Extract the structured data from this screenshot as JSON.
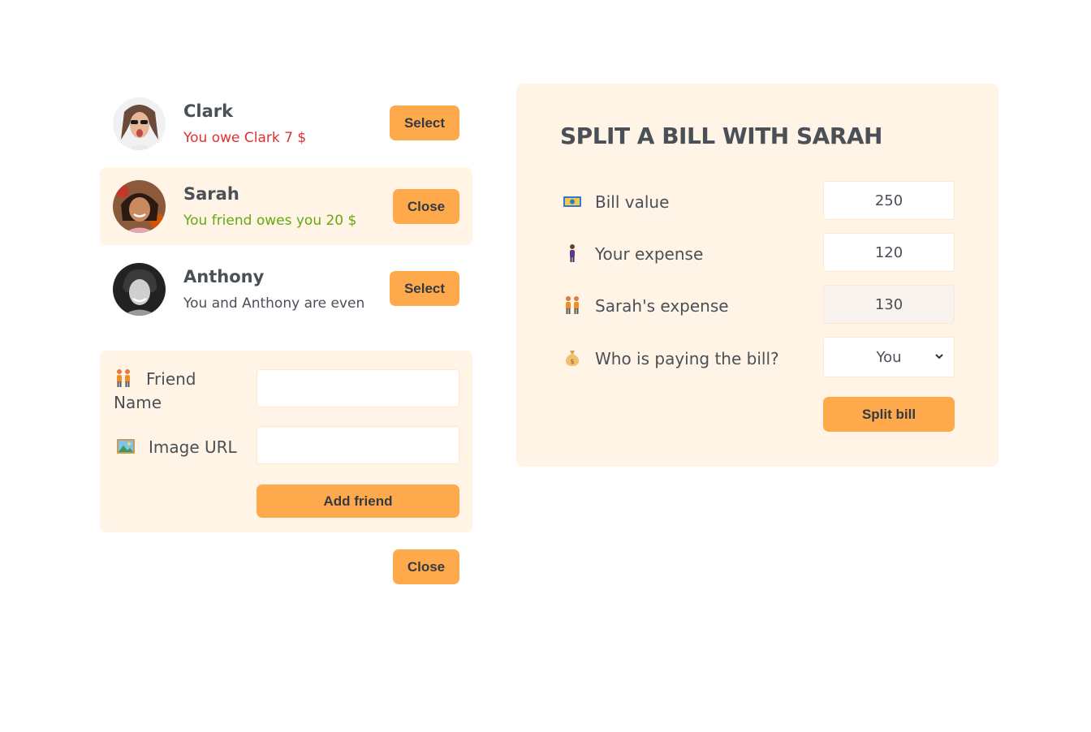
{
  "friends": [
    {
      "name": "Clark",
      "status": "You owe Clark 7 $",
      "button": "Select",
      "selected": false
    },
    {
      "name": "Sarah",
      "status": "You friend owes you 20 $",
      "button": "Close",
      "selected": true
    },
    {
      "name": "Anthony",
      "status": "You and Anthony are even",
      "button": "Select",
      "selected": false
    }
  ],
  "add_form": {
    "name_label": "Friend Name",
    "name_value": "",
    "image_label": "Image URL",
    "image_value": "",
    "submit": "Add friend",
    "name_icon": "two-people-icon",
    "image_icon": "picture-icon"
  },
  "close_form": "Close",
  "split": {
    "title": "SPLIT A BILL WITH SARAH",
    "bill_label": "Bill value",
    "bill_value": "250",
    "your_label": "Your expense",
    "your_value": "120",
    "friend_label": "Sarah's expense",
    "friend_value": "130",
    "payer_label": "Who is paying the bill?",
    "payer_value": "You",
    "submit": "Split bill",
    "icons": [
      "money-icon",
      "person-icon",
      "two-people-icon",
      "money-bag-icon"
    ]
  },
  "colors": {
    "accent": "#ffa94d",
    "panel": "#fff4e6",
    "red": "#e03131",
    "green": "#66a80f",
    "text": "#495057"
  }
}
